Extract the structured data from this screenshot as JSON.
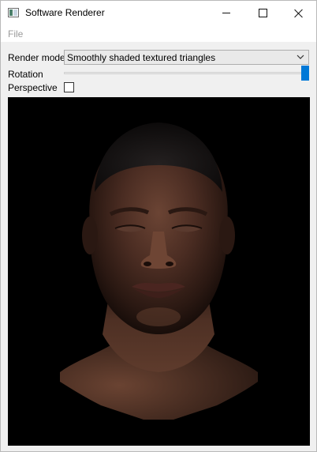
{
  "window": {
    "title": "Software Renderer"
  },
  "menu": {
    "file_label": "File"
  },
  "controls": {
    "render_mode_label": "Render mode",
    "render_mode_value": "Smoothly shaded textured triangles",
    "rotation_label": "Rotation",
    "rotation_fraction": 1.0,
    "perspective_label": "Perspective",
    "perspective_checked": false
  },
  "colors": {
    "accent": "#0078d7",
    "viewport_background": "#000000"
  },
  "icons": {
    "app": "app-window-icon",
    "minimize": "minimize-icon",
    "maximize": "maximize-icon",
    "close": "close-icon",
    "dropdown": "chevron-down-icon"
  }
}
